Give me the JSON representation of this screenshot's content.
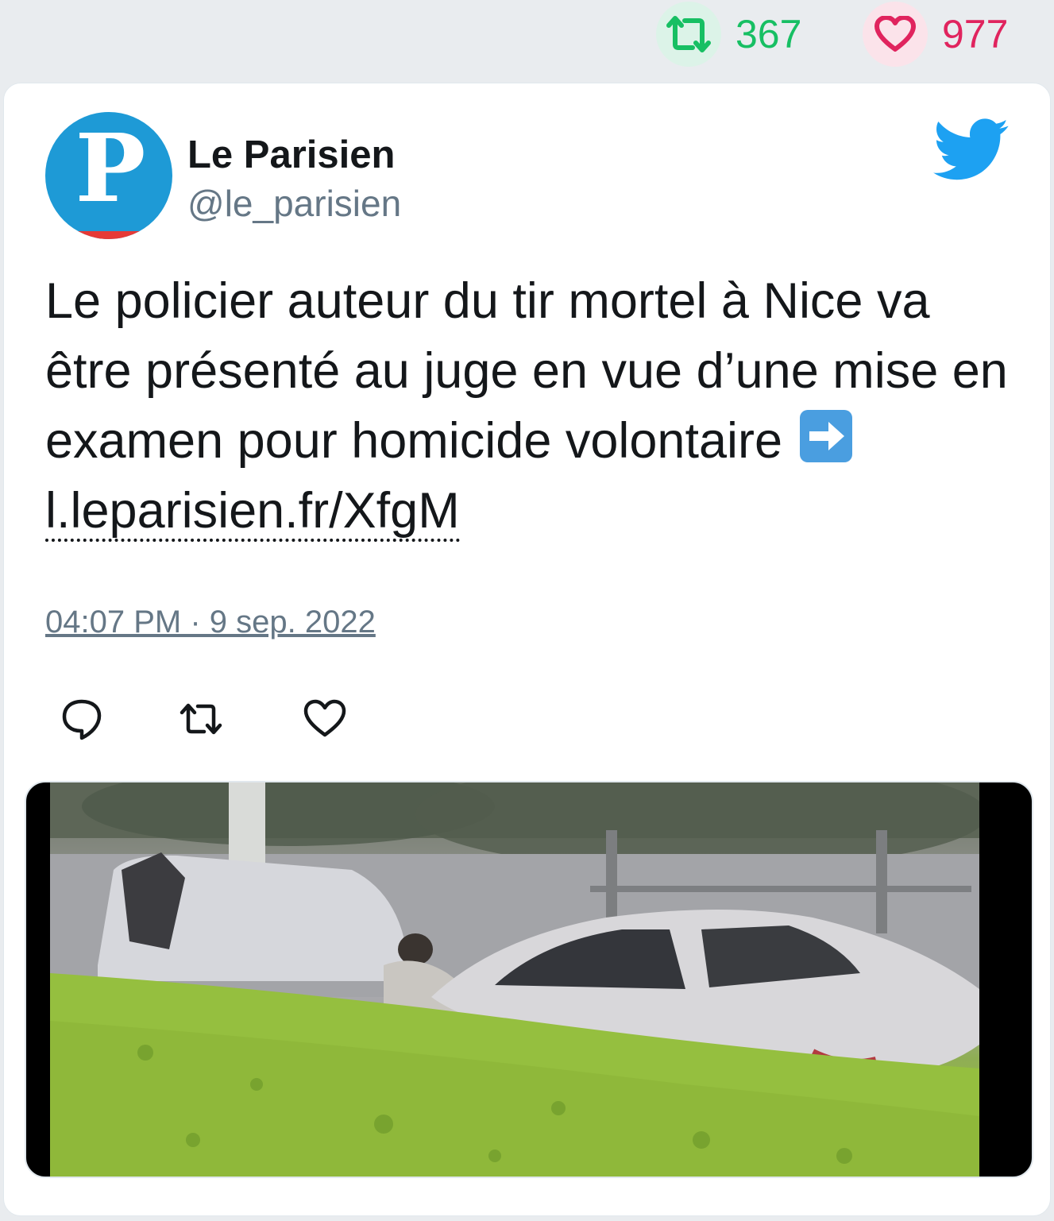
{
  "stats": {
    "retweets": "367",
    "likes": "977",
    "retweet_icon": "retweet-icon",
    "like_icon": "heart-icon"
  },
  "author": {
    "avatar_letter": "P",
    "name": "Le Parisien",
    "handle": "@le_parisien"
  },
  "tweet": {
    "text": "Le policier auteur du tir mortel à Nice va être présenté au juge en vue d’une mise en examen pour homicide volontaire ",
    "emoji": "arrow-right-emoji",
    "link": "l.leparisien.fr/XfgM",
    "timestamp": "04:07 PM · 9 sep. 2022"
  },
  "actions": [
    "reply-icon",
    "retweet-icon",
    "like-icon"
  ],
  "colors": {
    "retweet": "#17bf63",
    "like": "#e0245e",
    "twitter_blue": "#1da1f2",
    "muted": "#657786"
  }
}
